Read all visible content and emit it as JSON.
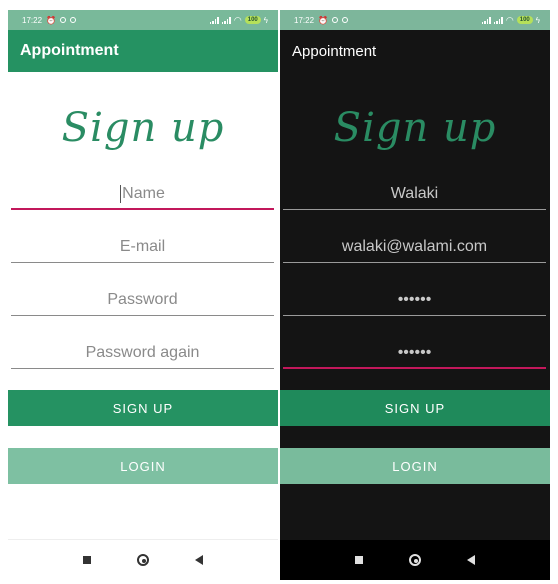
{
  "status_bar": {
    "time": "17:22",
    "battery": "100"
  },
  "light": {
    "app_title": "Appointment",
    "heading": "Sign up",
    "fields": {
      "name": "Name",
      "email": "E-mail",
      "password": "Password",
      "password_again": "Password again"
    },
    "signup_label": "SIGN UP",
    "login_label": "LOGIN"
  },
  "dark": {
    "app_title": "Appointment",
    "heading": "Sign up",
    "fields": {
      "name": "Walaki",
      "email": "walaki@walami.com",
      "password": "••••••",
      "password_again": "••••••"
    },
    "signup_label": "SIGN UP",
    "login_label": "LOGIN"
  },
  "colors": {
    "primary": "#259262",
    "accent_light": "#7ec0a2",
    "focus_underline": "#c2185b",
    "dark_background": "#141414"
  },
  "icons": [
    "alarm-icon",
    "sync-icon",
    "signal-icon",
    "wifi-icon",
    "battery-icon",
    "charging-icon",
    "recent-apps-icon",
    "home-icon",
    "back-icon"
  ]
}
